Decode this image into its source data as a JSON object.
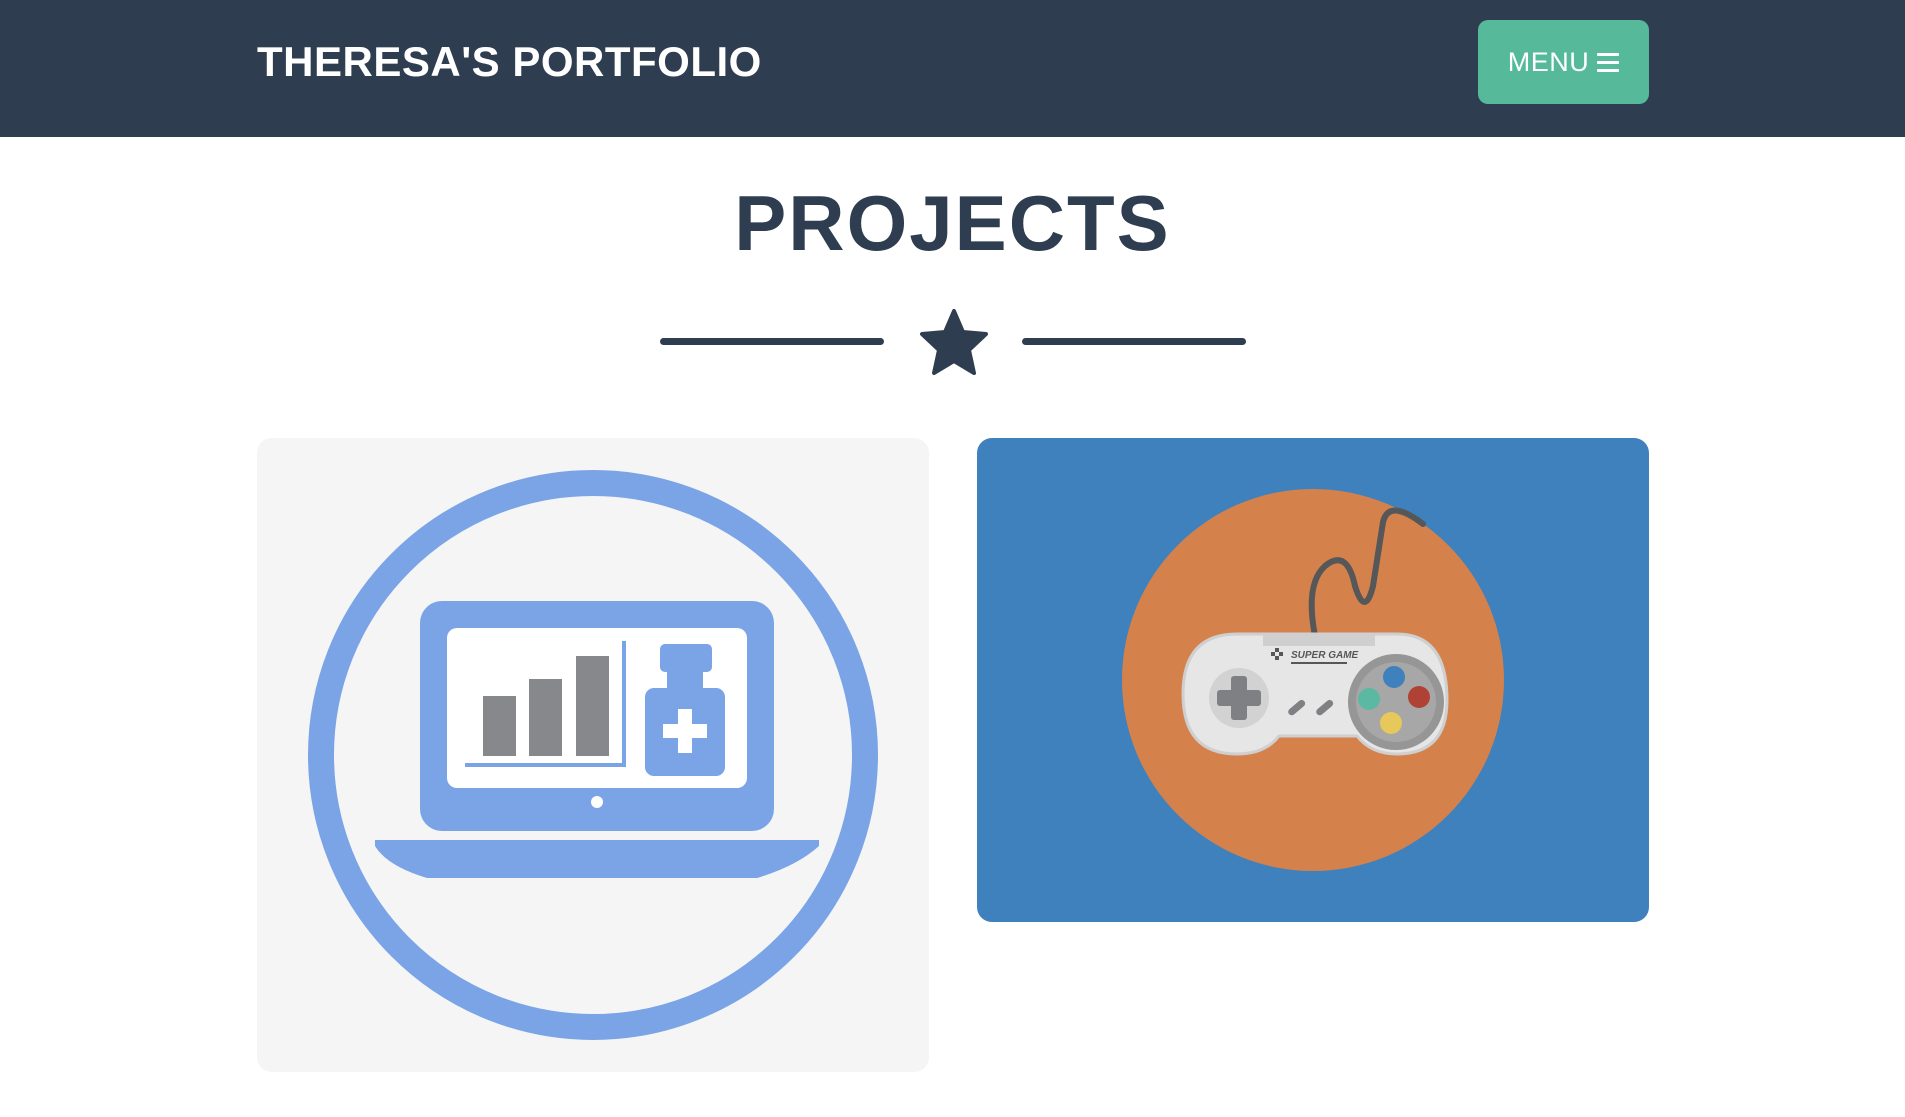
{
  "navbar": {
    "brand": "THERESA'S PORTFOLIO",
    "menu_label": "MENU",
    "background": "#2f3d51",
    "menu_color": "#55b99a"
  },
  "projects": {
    "title": "PROJECTS",
    "divider_icon": "star-icon",
    "items": [
      {
        "icon": "laptop-health-chart-icon",
        "background": "#f5f5f6",
        "accent": "#7aa4e6"
      },
      {
        "icon": "game-controller-icon",
        "background": "#3e81bd",
        "accent": "#d5814c",
        "logo_text": "SUPER GAME"
      }
    ]
  }
}
